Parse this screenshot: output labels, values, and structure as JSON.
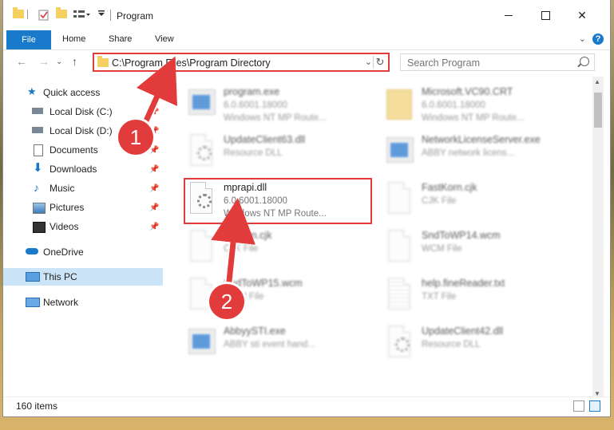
{
  "window": {
    "title": "Program"
  },
  "ribbon": {
    "tabs": [
      "File",
      "Home",
      "Share",
      "View"
    ],
    "help": "?"
  },
  "address": {
    "path": "C:\\Program Files\\Program Directory"
  },
  "search": {
    "placeholder": "Search Program"
  },
  "nav": {
    "items": [
      {
        "label": "Quick access",
        "icon": "star-icon"
      },
      {
        "label": "Local Disk (C:)",
        "icon": "drive-icon"
      },
      {
        "label": "Local Disk (D:)",
        "icon": "drive-icon"
      },
      {
        "label": "Documents",
        "icon": "documents-icon"
      },
      {
        "label": "Downloads",
        "icon": "download-icon"
      },
      {
        "label": "Music",
        "icon": "music-icon"
      },
      {
        "label": "Pictures",
        "icon": "pictures-icon"
      },
      {
        "label": "Videos",
        "icon": "videos-icon"
      },
      {
        "label": "OneDrive",
        "icon": "cloud-icon"
      },
      {
        "label": "This PC",
        "icon": "computer-icon"
      },
      {
        "label": "Network",
        "icon": "network-icon"
      }
    ]
  },
  "files": [
    {
      "name": "program.exe",
      "line2": "6.0.6001.18000",
      "line3": "Windows NT MP Route...",
      "icon": "exe-icon"
    },
    {
      "name": "Microsoft.VC90.CRT",
      "line2": "6.0.6001.18000",
      "line3": "Windows NT MP Route...",
      "icon": "folder-icon"
    },
    {
      "name": "UpdateClient63.dll",
      "line2": "Resource DLL",
      "line3": "",
      "icon": "dll-icon"
    },
    {
      "name": "NetworkLicenseServer.exe",
      "line2": "ABBY network licens...",
      "line3": "",
      "icon": "exe-icon"
    },
    {
      "name": "mprapi.dll",
      "line2": "6.0.6001.18000",
      "line3": "Windows NT MP Route...",
      "icon": "dll-icon"
    },
    {
      "name": "FastKorn.cjk",
      "line2": "CJK File",
      "line3": "",
      "icon": "file-icon"
    },
    {
      "name": "EdKorn.cjk",
      "line2": "CJK File",
      "line3": "",
      "icon": "file-icon"
    },
    {
      "name": "SndToWP14.wcm",
      "line2": "WCM File",
      "line3": "",
      "icon": "file-icon"
    },
    {
      "name": "SndToWP15.wcm",
      "line2": "WCM File",
      "line3": "",
      "icon": "file-icon"
    },
    {
      "name": "help.fineReader.txt",
      "line2": "TXT File",
      "line3": "",
      "icon": "txt-icon"
    },
    {
      "name": "AbbyySTI.exe",
      "line2": "ABBY sti event hand...",
      "line3": "",
      "icon": "exe-icon"
    },
    {
      "name": "UpdateClient42.dll",
      "line2": "Resource DLL",
      "line3": "",
      "icon": "dll-icon"
    }
  ],
  "status": {
    "count": "160 items"
  },
  "annotations": {
    "step1": "1",
    "step2": "2"
  },
  "colors": {
    "accent": "#1979ca",
    "highlight": "#e23b3b",
    "selected": "#cce4f7"
  }
}
